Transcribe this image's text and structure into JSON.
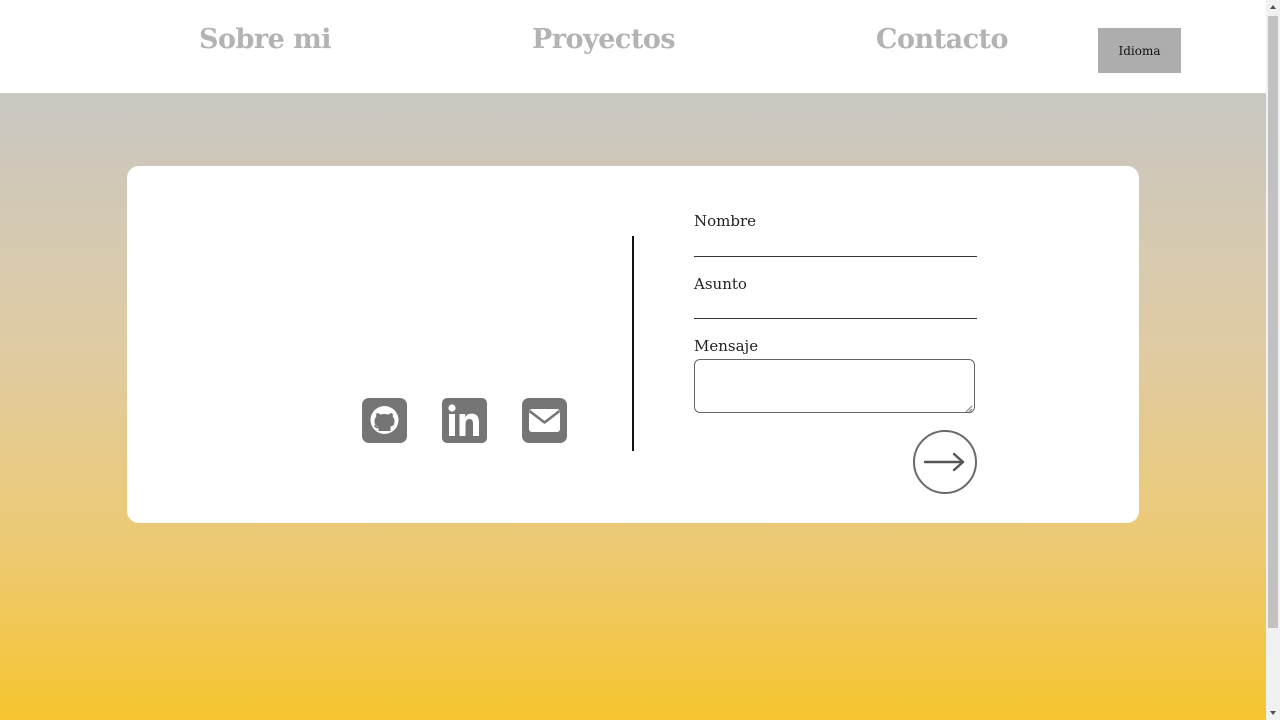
{
  "nav": {
    "about": "Sobre mi",
    "projects": "Proyectos",
    "contact": "Contacto",
    "language_button": "Idioma"
  },
  "social": [
    {
      "icon": "github-icon"
    },
    {
      "icon": "linkedin-icon"
    },
    {
      "icon": "email-icon"
    }
  ],
  "form": {
    "name_label": "Nombre",
    "name_value": "",
    "subject_label": "Asunto",
    "subject_value": "",
    "message_label": "Mensaje",
    "message_value": "",
    "send_icon": "arrow-right-icon"
  },
  "colors": {
    "nav_text": "#b3b3b3",
    "language_button_bg": "#adadad",
    "gradient_top": "#c9c7c2",
    "gradient_bottom": "#f6c52e",
    "icon_gray": "#757575"
  }
}
